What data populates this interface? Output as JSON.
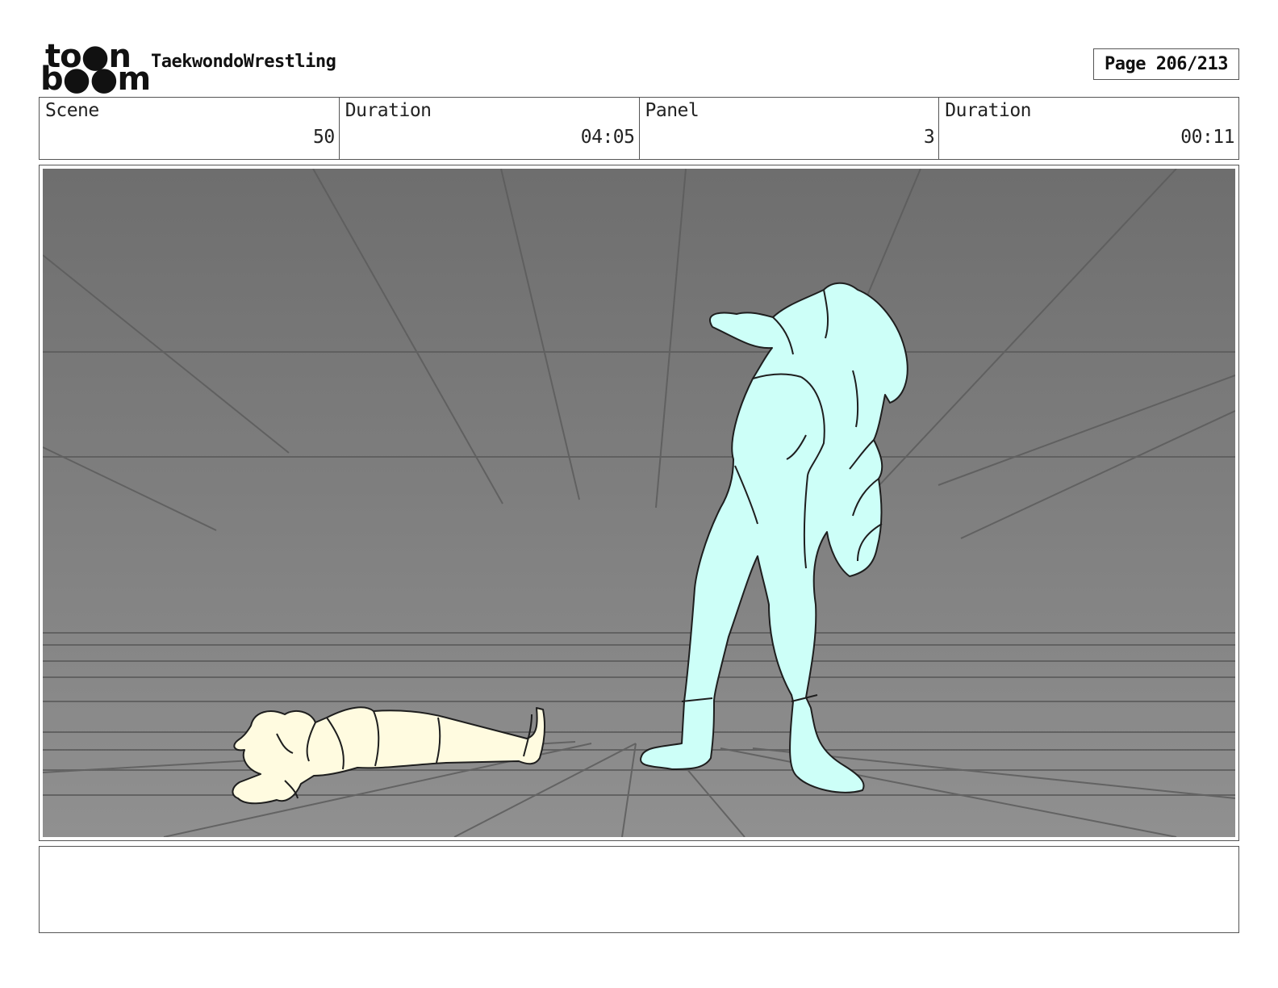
{
  "header": {
    "logo_top": "to●n",
    "logo_bottom": "b●●m",
    "project_title": "TaekwondoWrestling",
    "page_label": "Page 206/213"
  },
  "info": {
    "scene_label": "Scene",
    "scene_value": "50",
    "scene_duration_label": "Duration",
    "scene_duration_value": "04:05",
    "panel_label": "Panel",
    "panel_value": "3",
    "panel_duration_label": "Duration",
    "panel_duration_value": "00:11"
  },
  "panel": {
    "background_top": "#6e6e6e",
    "background_bottom": "#909090",
    "standing_figure_color": "#cdfff8",
    "lying_figure_color": "#fffbe0"
  },
  "notes": {
    "text": ""
  }
}
